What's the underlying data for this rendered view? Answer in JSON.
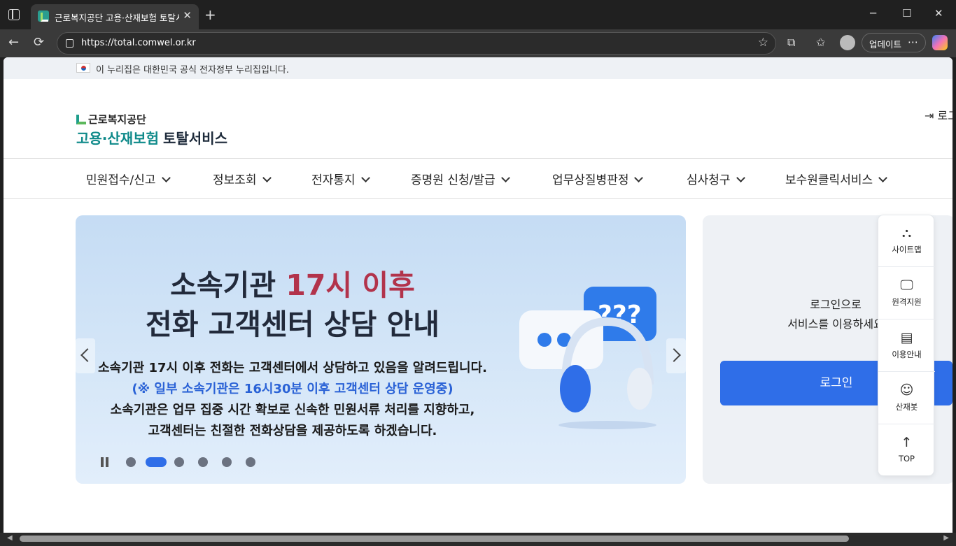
{
  "browser": {
    "tab_title": "근로복지공단 고용·산재보험 토탈서비스",
    "url": "https://total.comwel.or.kr",
    "update_label": "업데이트",
    "tab_close": "✕",
    "new_tab": "+",
    "minimize": "─",
    "maximize": "☐",
    "close": "✕",
    "back": "←",
    "reload": "⟳",
    "more": "⋯",
    "star": "☆",
    "extensions": "⧉",
    "favorites": "✩"
  },
  "gov_bar": {
    "text": "이 누리집은 대한민국 공식 전자정부 누리집입니다."
  },
  "logo": {
    "org": "근로복지공단",
    "service_teal": "고용·산재보험",
    "service_dark": "토탈서비스"
  },
  "header": {
    "login_link": "로그인",
    "login_icon": "⇥"
  },
  "gnb": {
    "items": [
      {
        "label": "민원접수/신고"
      },
      {
        "label": "정보조회"
      },
      {
        "label": "전자통지"
      },
      {
        "label": "증명원 신청/발급"
      },
      {
        "label": "업무상질병판정"
      },
      {
        "label": "심사청구"
      },
      {
        "label": "보수원클릭서비스"
      }
    ]
  },
  "banner": {
    "title_line1_prefix": "소속기관 ",
    "title_line1_highlight": "17시 이후",
    "title_line2": "전화 고객센터 상담 안내",
    "body_line1": "소속기관 17시 이후 전화는 고객센터에서 상담하고 있음을 알려드립니다.",
    "body_line2": "(※ 일부 소속기관은 16시30분 이후 고객센터 상담 운영중)",
    "body_line3": "소속기관은 업무 집중 시간 확보로 신속한 민원서류 처리를 지향하고,",
    "body_line4": "고객센터는 친절한 전화상담을 제공하도록 하겠습니다.",
    "slide_count": 6,
    "active_slide": 2,
    "question_marks": "???"
  },
  "login_panel": {
    "message_line1": "로그인으로",
    "message_line2": "서비스를 이용하세요",
    "button_label": "로그인"
  },
  "quick_menu": {
    "items": [
      {
        "label": "사이트맵",
        "icon": "sitemap-icon",
        "glyph": "⛬"
      },
      {
        "label": "원격지원",
        "icon": "remote-support-icon",
        "glyph": "🖵"
      },
      {
        "label": "이용안내",
        "icon": "guide-icon",
        "glyph": "▤"
      },
      {
        "label": "산재봇",
        "icon": "chatbot-icon",
        "glyph": "☺"
      },
      {
        "label": "TOP",
        "icon": "arrow-up-icon",
        "glyph": "↑"
      }
    ]
  },
  "colors": {
    "brand_teal": "#0f8a8a",
    "primary_blue": "#2f6ee8",
    "highlight_red": "#b2334b"
  }
}
